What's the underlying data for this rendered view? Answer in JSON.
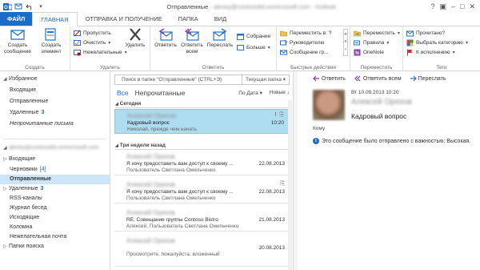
{
  "window": {
    "title": "Отправленные",
    "account_blurred": "alexey@contosoltd.onmicrosoft.com",
    "app_name_blurred": "Outlook"
  },
  "tabs": [
    "ФАЙЛ",
    "ГЛАВНАЯ",
    "ОТПРАВКА И ПОЛУЧЕНИЕ",
    "ПАПКА",
    "ВИД"
  ],
  "ribbon": {
    "create": {
      "label": "Создать",
      "new_message": "Создать сообщение",
      "new_items": "Создать элемент"
    },
    "delete": {
      "label": "Удалить",
      "ignore": "Пропустить",
      "clean_up": "Очистить",
      "junk": "Нежелательные",
      "delete": "Удалить"
    },
    "respond": {
      "label": "Ответить",
      "reply": "Ответить",
      "reply_all": "Ответить всем",
      "forward": "Переслать",
      "meeting": "Собрание",
      "more": "Больше"
    },
    "quick_steps": {
      "label": "Быстрые действия",
      "items": [
        "Переместить в: ?",
        "Руководителю",
        "Сообщение гр..."
      ]
    },
    "move": {
      "label": "Переместить",
      "move": "Переместить",
      "rules": "Правила",
      "onenote": "OneNote"
    },
    "tags": {
      "label": "Теги",
      "read": "Прочитано?",
      "categorize": "Выбрать категорию",
      "followup": "К исполнению"
    }
  },
  "nav": {
    "favorites_header": "Избранное",
    "favorites": [
      {
        "label": "Входящие",
        "count": ""
      },
      {
        "label": "Отправленные",
        "count": ""
      },
      {
        "label": "Удаленные",
        "count": "3"
      },
      {
        "label": "Непрочитанные письма",
        "count": ""
      }
    ],
    "account_blurred": "alexey@contosoltd.onmicrosoft.com",
    "folders": [
      {
        "label": "Входящие",
        "count": ""
      },
      {
        "label": "Черновики",
        "count": "[4]"
      },
      {
        "label": "Отправленные",
        "count": ""
      },
      {
        "label": "Удаленные",
        "count": "3"
      },
      {
        "label": "RSS-каналы",
        "count": ""
      },
      {
        "label": "Журнал бесед",
        "count": ""
      },
      {
        "label": "Исходящие",
        "count": ""
      },
      {
        "label": "Коломна",
        "count": ""
      },
      {
        "label": "Нежелательная почта",
        "count": ""
      },
      {
        "label": "Папки поиска",
        "count": ""
      }
    ]
  },
  "list": {
    "search_placeholder": "Поиск в папке \"Отправленные\" (CTRL+Э)",
    "search_scope": "Текущая папка",
    "filter_all": "Все",
    "filter_unread": "Непрочитанные",
    "sort_by": "По Дата",
    "sort_order": "Новые",
    "groups": [
      {
        "label": "Сегодня",
        "messages": [
          {
            "from": "Алексей Орехов",
            "subject": "Кадровый вопрос",
            "preview": "Николай, прежде чем начать",
            "date": "10:20",
            "selected": true,
            "flags": "! ⎘"
          }
        ]
      },
      {
        "label": "Три недели назад",
        "messages": [
          {
            "from": "Алексей Орехов",
            "subject": "Я хочу предоставить вам доступ к своему ...",
            "preview": "Пользователь Светлана Омельченко",
            "date": "22.08.2013",
            "selected": false,
            "flags": ""
          },
          {
            "from": "Алексей Орехов",
            "subject": "Я хочу предоставить вам доступ к своему ...",
            "preview": "Пользователь Светлана Омельченко",
            "date": "22.08.2013",
            "selected": false,
            "flags": "⎘"
          },
          {
            "from": "Алексей Орехов",
            "subject": "RE: Совещание группы Contoso Bistro",
            "preview": "Алексей, Пользователь Светлана Омельченко",
            "date": "21.08.2013",
            "selected": false,
            "flags": ""
          },
          {
            "from": "Алексей Орехов",
            "subject": "",
            "preview": "Просмотрите, пожалуйста, вложенный",
            "date": "20.08.2013",
            "selected": false,
            "flags": ""
          }
        ]
      }
    ]
  },
  "reading": {
    "actions": [
      "Ответить",
      "Ответить всем",
      "Переслать"
    ],
    "date": "Вт 10.09.2013 10:20",
    "from": "Алексей Орехов",
    "subject": "Кадровый вопрос",
    "to_label": "Кому",
    "importance_note": "Это сообщение было отправлено с важностью: Высокая."
  }
}
